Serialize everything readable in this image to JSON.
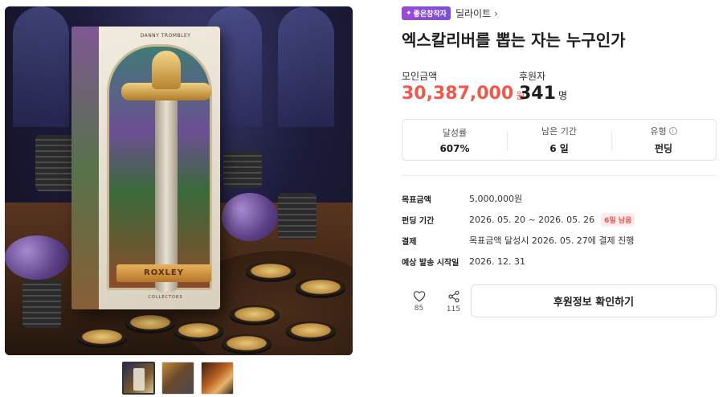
{
  "product": {
    "image_alt": "Excalibur box art",
    "box_author": "DANNY TROMBLEY",
    "box_banner": "ROXLEY",
    "box_footer": "COLLECTORS",
    "thumbnails": [
      "thumb-1",
      "thumb-2",
      "thumb-3"
    ]
  },
  "category": {
    "badge": "좋은창작자",
    "creator": "딜라이트",
    "chevron": "›"
  },
  "title": "엑스칼리버를 뽑는 자는 누구인가",
  "stats": {
    "raised_label": "모인금액",
    "raised_value": "30,387,000",
    "raised_unit": "원",
    "backers_label": "후원자",
    "backers_value": "341",
    "backers_unit": "명"
  },
  "summary": {
    "achieve_label": "달성률",
    "achieve_value": "607%",
    "remaining_label": "남은 기간",
    "remaining_value": "6 일",
    "type_label": "유형",
    "type_value": "펀딩",
    "type_info": "i"
  },
  "details": {
    "goal_label": "목표금액",
    "goal_value": "5,000,000원",
    "period_label": "펀딩 기간",
    "period_value": "2026. 05. 20 ~ 2026. 05. 26",
    "period_tag": "6일 남음",
    "payment_label": "결제",
    "payment_value": "목표금액 달성시 2026. 05. 27에 결제 진행",
    "ship_label": "예상 발송 시작일",
    "ship_value": "2026. 12. 31"
  },
  "actions": {
    "like_count": "85",
    "share_count": "115",
    "support_label": "후원정보 확인하기"
  },
  "colors": {
    "accent_red": "#f1584a",
    "badge_purple": "#8b5cf6"
  }
}
